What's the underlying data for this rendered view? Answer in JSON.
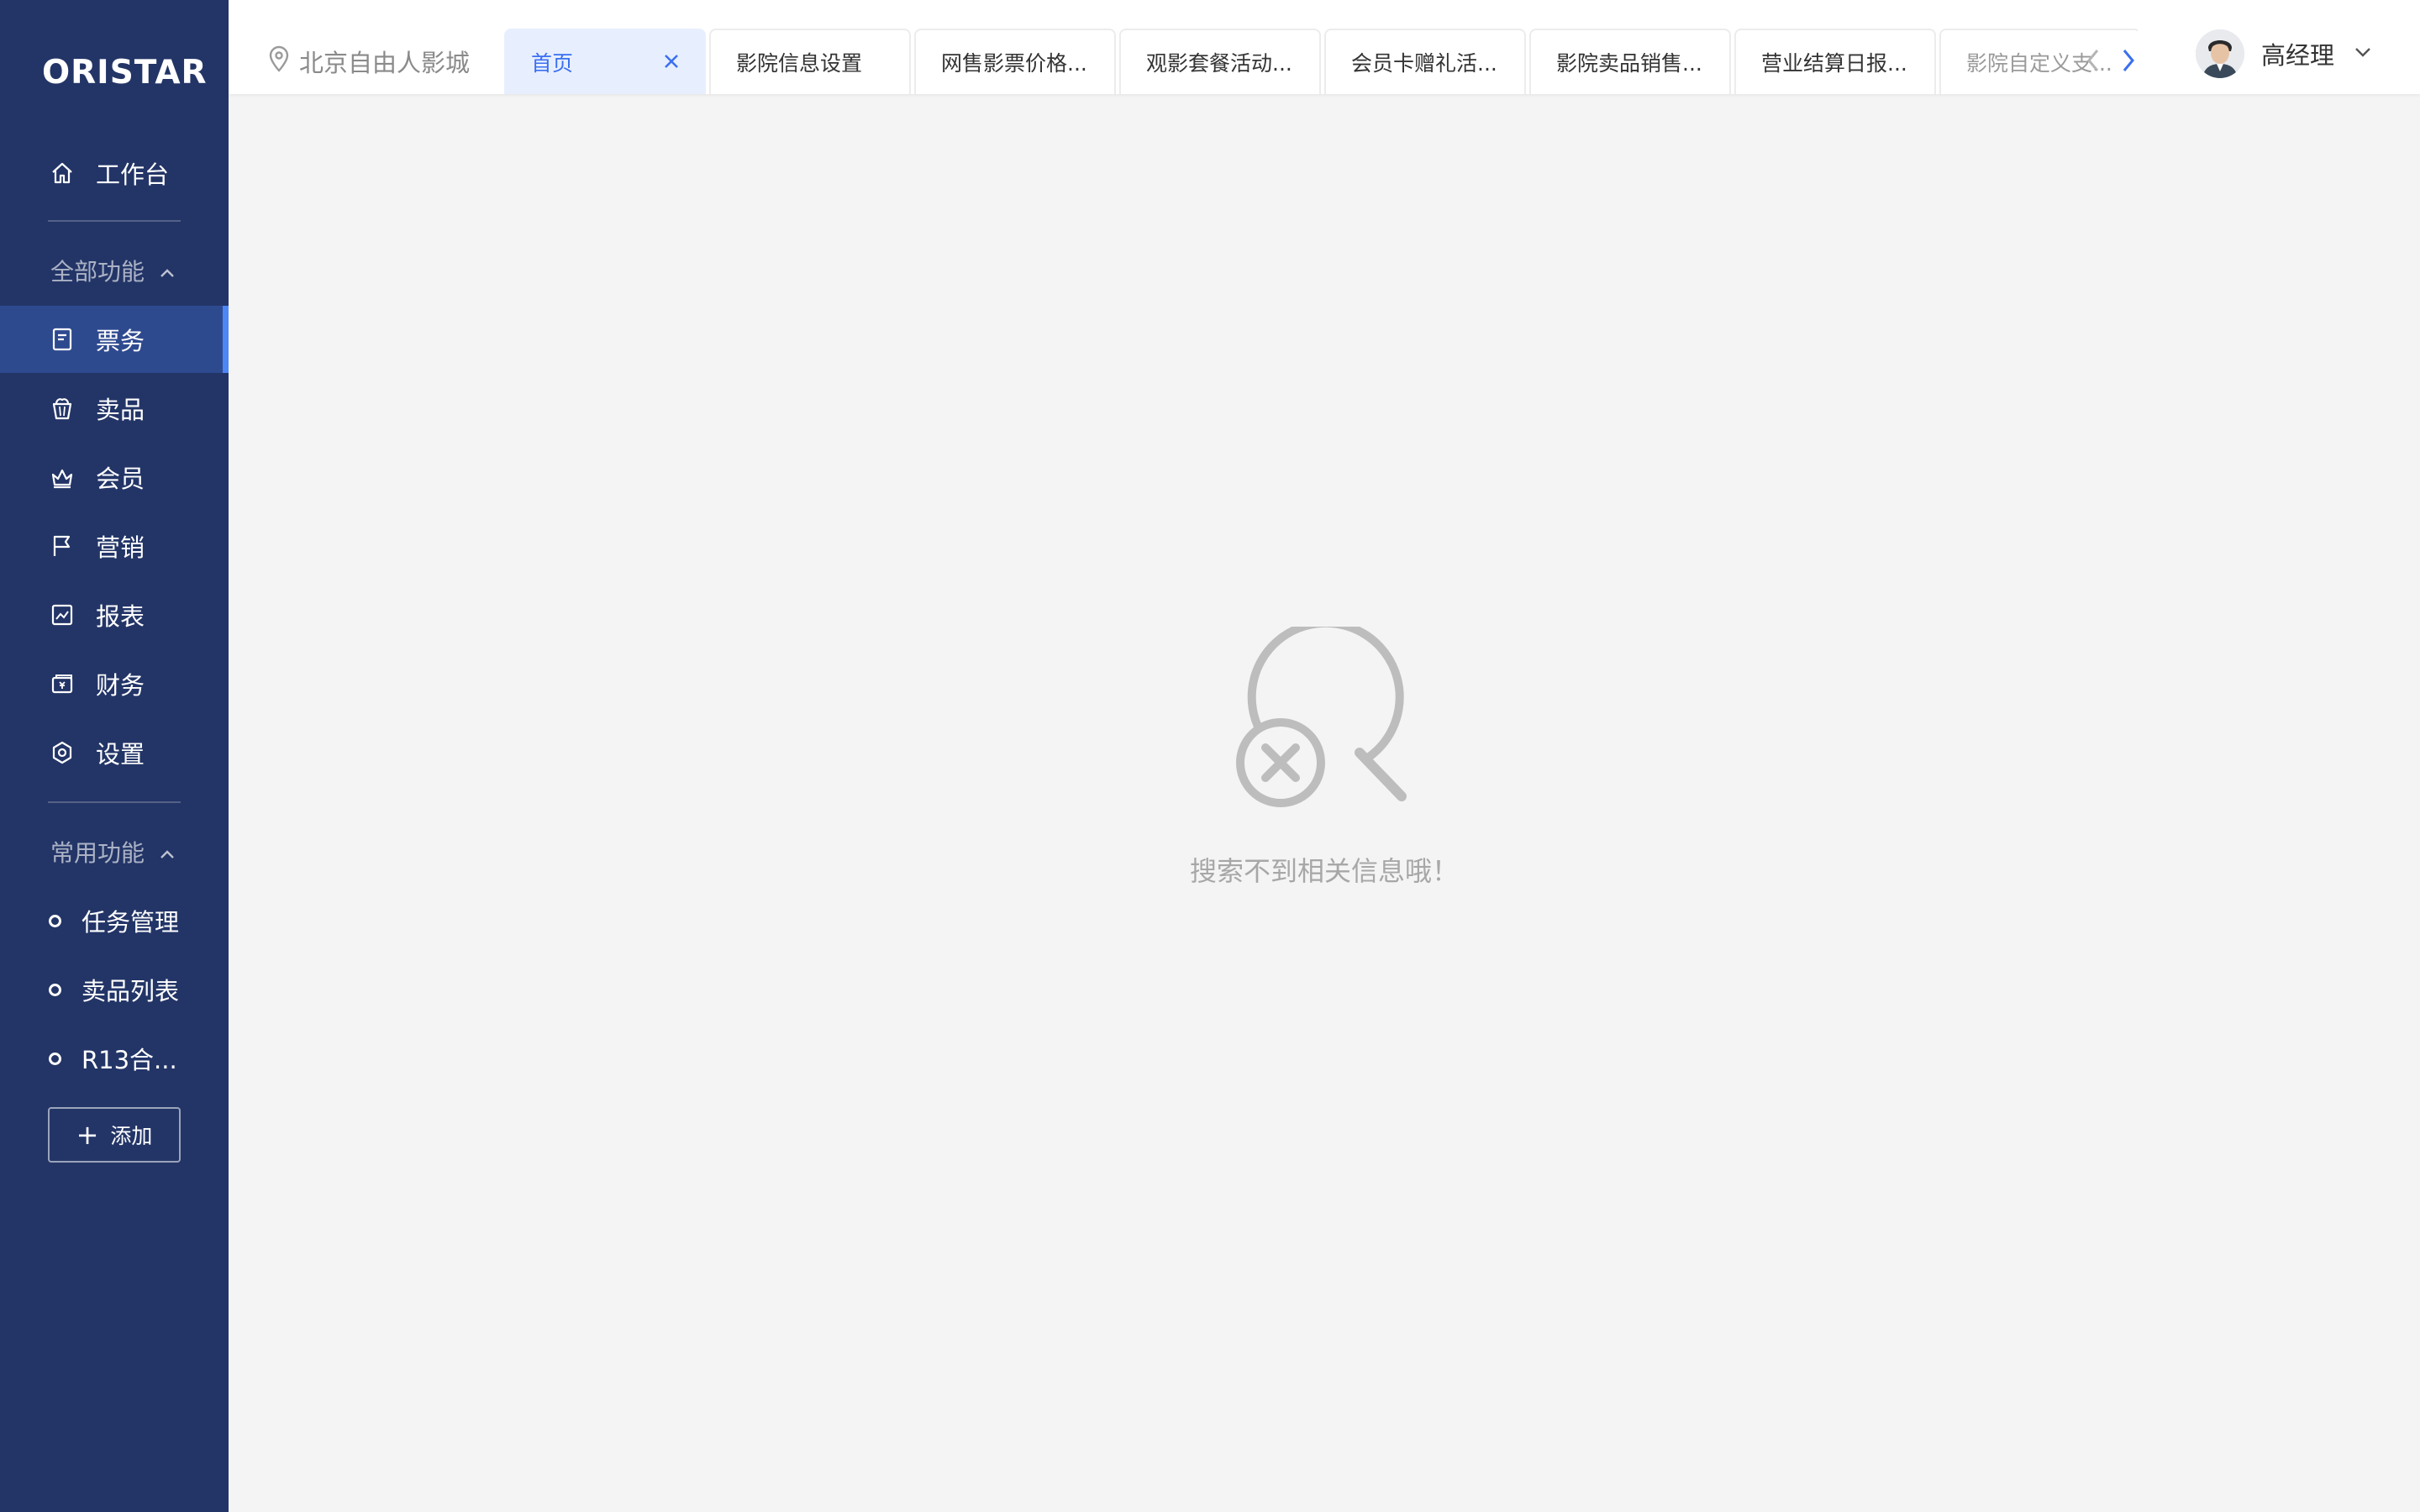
{
  "app": {
    "logo_text": "ORISTAR",
    "brand_colors": {
      "sidebar_bg": "#233567",
      "active_item_bg": "#2e4a8f",
      "accent": "#3a6ff0"
    }
  },
  "sidebar": {
    "workbench_label": "工作台",
    "all_features_label": "全部功能",
    "items": [
      {
        "label": "票务",
        "icon": "ticket-icon",
        "active": true
      },
      {
        "label": "卖品",
        "icon": "popcorn-icon",
        "active": false
      },
      {
        "label": "会员",
        "icon": "crown-icon",
        "active": false
      },
      {
        "label": "营销",
        "icon": "flag-icon",
        "active": false
      },
      {
        "label": "报表",
        "icon": "chart-icon",
        "active": false
      },
      {
        "label": "财务",
        "icon": "finance-icon",
        "active": false
      },
      {
        "label": "设置",
        "icon": "gear-icon",
        "active": false
      }
    ],
    "common_features_label": "常用功能",
    "favorites": [
      {
        "label": "任务管理"
      },
      {
        "label": "卖品列表"
      },
      {
        "label": "R13合..."
      }
    ],
    "add_button_label": "添加"
  },
  "topbar": {
    "location": "北京自由人影城",
    "tabs": [
      {
        "label": "首页",
        "active": true
      },
      {
        "label": "影院信息设置"
      },
      {
        "label": "网售影票价格..."
      },
      {
        "label": "观影套餐活动..."
      },
      {
        "label": "会员卡赠礼活..."
      },
      {
        "label": "影院卖品销售..."
      },
      {
        "label": "营业结算日报..."
      },
      {
        "label": "影院自定义支..."
      }
    ],
    "user_name": "高经理"
  },
  "main": {
    "empty_message": "搜索不到相关信息哦！"
  }
}
